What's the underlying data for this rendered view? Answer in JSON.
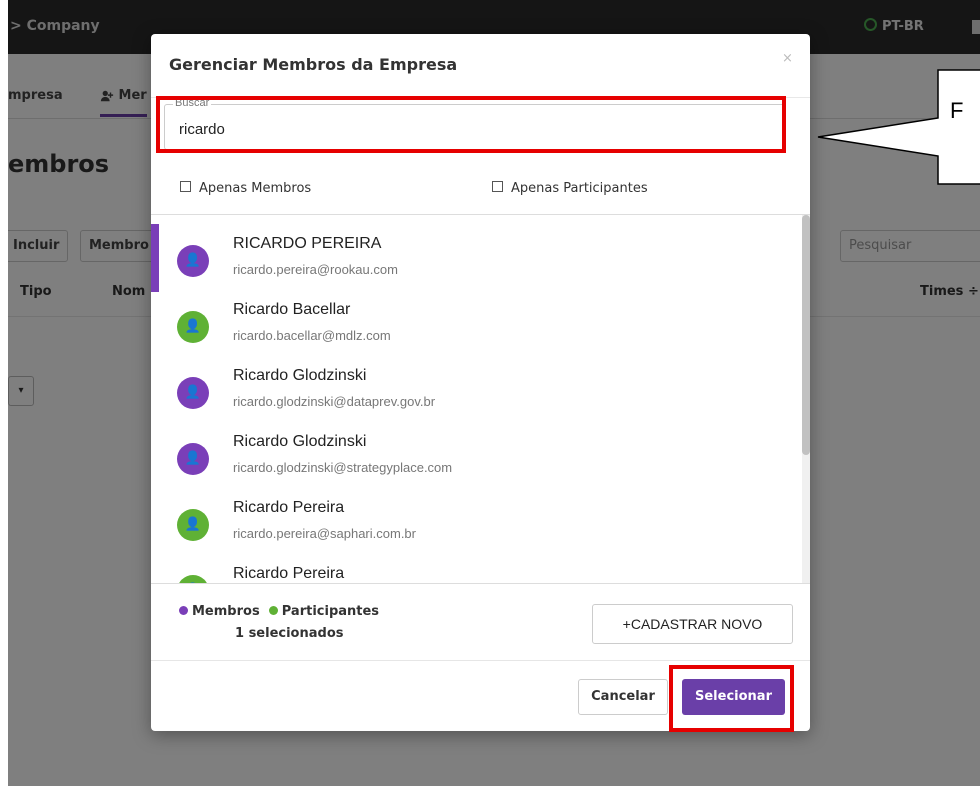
{
  "background": {
    "breadcrumb": "> Company",
    "language": "PT-BR",
    "tabs": [
      "mpresa",
      "Mer"
    ],
    "page_heading": "embros",
    "buttons": [
      "Incluir",
      "Membro"
    ],
    "search_placeholder": "Pesquisar",
    "table_headers": {
      "tipo": "Tipo",
      "nome": "Nom",
      "times": "Times ÷"
    }
  },
  "callout": {
    "text": "F"
  },
  "modal": {
    "title": "Gerenciar Membros da Empresa",
    "close": "×",
    "search": {
      "legend": "Buscar",
      "value": "ricardo"
    },
    "filters": {
      "only_members": "Apenas Membros",
      "only_participants": "Apenas Participantes"
    },
    "results": [
      {
        "name": "RICARDO PEREIRA",
        "email": "ricardo.pereira@rookau.com",
        "type": "member"
      },
      {
        "name": "Ricardo Bacellar",
        "email": "ricardo.bacellar@mdlz.com",
        "type": "participant"
      },
      {
        "name": "Ricardo Glodzinski",
        "email": "ricardo.glodzinski@dataprev.gov.br",
        "type": "member"
      },
      {
        "name": "Ricardo Glodzinski",
        "email": "ricardo.glodzinski@strategyplace.com",
        "type": "member"
      },
      {
        "name": "Ricardo Pereira",
        "email": "ricardo.pereira@saphari.com.br",
        "type": "participant"
      },
      {
        "name": "Ricardo Pereira",
        "email": "",
        "type": "participant"
      }
    ],
    "legend": {
      "members": "Membros",
      "participants": "Participantes"
    },
    "selected_count": "1 selecionados",
    "new_button": "+CADASTRAR NOVO",
    "cancel_button": "Cancelar",
    "select_button": "Selecionar"
  },
  "colors": {
    "member": "#7a3fb8",
    "participant": "#5fb135",
    "primary": "#6a3fa8",
    "highlight": "#e60000"
  }
}
